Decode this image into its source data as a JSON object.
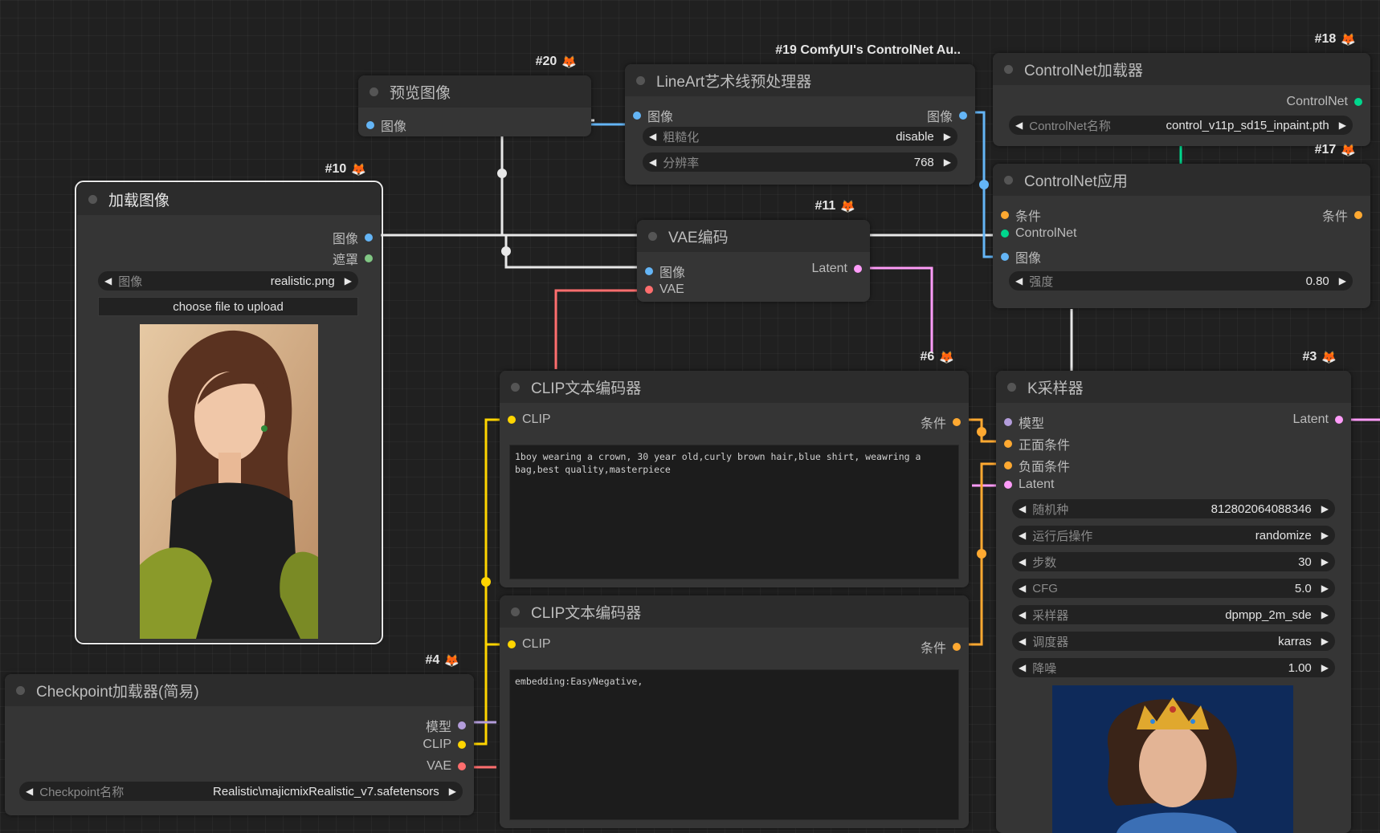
{
  "colors": {
    "canvas": "#202020",
    "node_body": "#353535",
    "node_header": "#2c2c2c",
    "image_wire": "#64b5f6",
    "mask_wire": "#81c784",
    "latent_wire": "#ff9cf9",
    "vae_wire": "#ff6e6e",
    "clip_wire": "#ffd500",
    "cond_wire": "#ffa931",
    "model_wire": "#b39ddb",
    "controlnet_wire": "#00d78d",
    "badge_icon": "#e85a1f"
  },
  "badge_icon": "fox-icon",
  "nodes": {
    "preview": {
      "id": "#20",
      "title": "预览图像",
      "inputs": [
        "图像"
      ]
    },
    "lineart": {
      "id": "#19 ComfyUI's ControlNet Au..",
      "title": "LineArt艺术线预处理器",
      "input": "图像",
      "output": "图像",
      "widgets": [
        {
          "label": "粗糙化",
          "value": "disable"
        },
        {
          "label": "分辨率",
          "value": "768"
        }
      ]
    },
    "cn_loader": {
      "id": "#18",
      "title": "ControlNet加载器",
      "output": "ControlNet",
      "widget": {
        "label": "ControlNet名称",
        "value": "control_v11p_sd15_inpaint.pth"
      }
    },
    "load_image": {
      "id": "#10",
      "title": "加载图像",
      "outputs": [
        "图像",
        "遮罩"
      ],
      "widget": {
        "label": "图像",
        "value": "realistic.png"
      },
      "upload_label": "choose file to upload",
      "image_alt": "realistic.png preview"
    },
    "vae_encode": {
      "id": "#11",
      "title": "VAE编码",
      "inputs": [
        "图像",
        "VAE"
      ],
      "output": "Latent"
    },
    "cn_apply": {
      "id": "#17",
      "title": "ControlNet应用",
      "inputs": [
        "条件",
        "ControlNet",
        "图像"
      ],
      "output": "条件",
      "widget": {
        "label": "强度",
        "value": "0.80"
      }
    },
    "clip_pos": {
      "id": "#6",
      "title": "CLIP文本编码器",
      "input": "CLIP",
      "output": "条件",
      "text": "1boy wearing a crown, 30 year old,curly brown hair,blue shirt, weawring a bag,best quality,masterpiece"
    },
    "clip_neg": {
      "title": "CLIP文本编码器",
      "input": "CLIP",
      "output": "条件",
      "text": "embedding:EasyNegative,"
    },
    "ksampler": {
      "id": "#3",
      "title": "K采样器",
      "inputs": [
        "模型",
        "正面条件",
        "负面条件",
        "Latent"
      ],
      "output": "Latent",
      "widgets": [
        {
          "label": "随机种",
          "value": "812802064088346"
        },
        {
          "label": "运行后操作",
          "value": "randomize"
        },
        {
          "label": "步数",
          "value": "30"
        },
        {
          "label": "CFG",
          "value": "5.0"
        },
        {
          "label": "采样器",
          "value": "dpmpp_2m_sde"
        },
        {
          "label": "调度器",
          "value": "karras"
        },
        {
          "label": "降噪",
          "value": "1.00"
        }
      ]
    },
    "checkpoint": {
      "id": "#4",
      "title": "Checkpoint加载器(简易)",
      "outputs": [
        "模型",
        "CLIP",
        "VAE"
      ],
      "widget": {
        "label": "Checkpoint名称",
        "value": "Realistic\\majicmixRealistic_v7.safetensors"
      }
    }
  }
}
